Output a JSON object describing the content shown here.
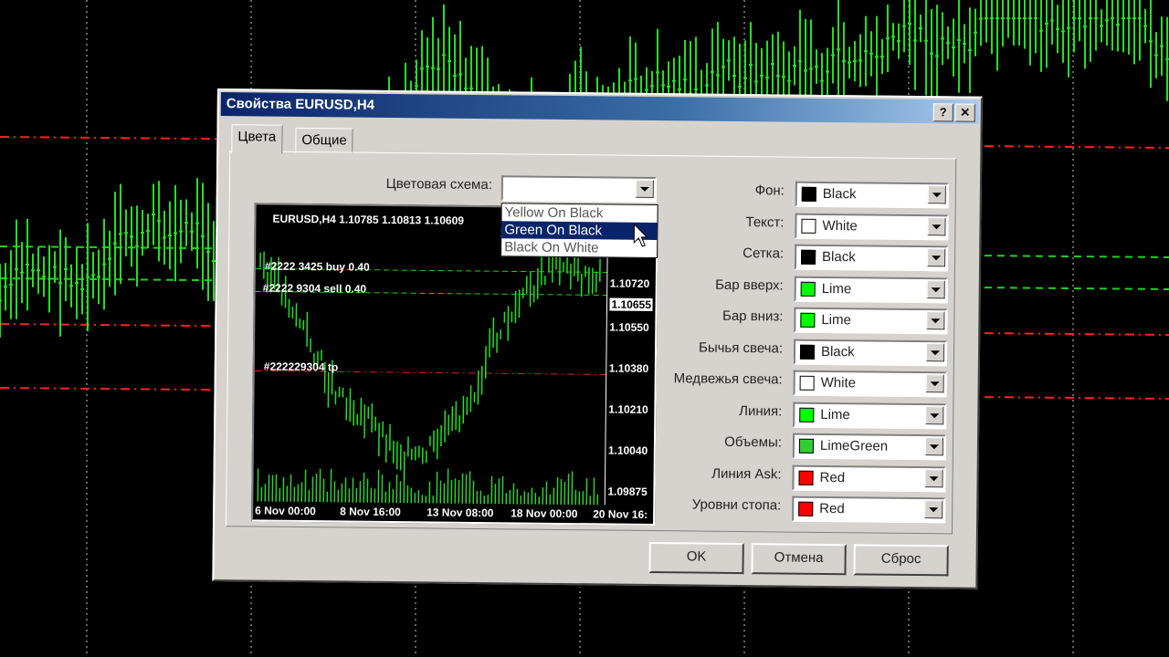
{
  "dialog": {
    "title": "Свойства EURUSD,H4",
    "help_btn": "?",
    "close_btn": "✕",
    "tabs": [
      {
        "label": "Цвета"
      },
      {
        "label": "Общие"
      }
    ],
    "scheme_label": "Цветовая схема:",
    "scheme_value": "",
    "scheme_options": [
      "Yellow On Black",
      "Green On Black",
      "Black On White"
    ],
    "scheme_highlighted": "Green On Black",
    "settings": [
      {
        "label": "Фон:",
        "value": "Black",
        "color": "#000000"
      },
      {
        "label": "Текст:",
        "value": "White",
        "color": "#ffffff"
      },
      {
        "label": "Сетка:",
        "value": "Black",
        "color": "#000000"
      },
      {
        "label": "Бар вверх:",
        "value": "Lime",
        "color": "#00ff00"
      },
      {
        "label": "Бар вниз:",
        "value": "Lime",
        "color": "#00ff00"
      },
      {
        "label": "Бычья свеча:",
        "value": "Black",
        "color": "#000000"
      },
      {
        "label": "Медвежья свеча:",
        "value": "White",
        "color": "#ffffff"
      },
      {
        "label": "Линия:",
        "value": "Lime",
        "color": "#00ff00"
      },
      {
        "label": "Объемы:",
        "value": "LimeGreen",
        "color": "#32cd32"
      },
      {
        "label": "Линия Ask:",
        "value": "Red",
        "color": "#ff0000"
      },
      {
        "label": "Уровни стопа:",
        "value": "Red",
        "color": "#ff0000"
      }
    ],
    "buttons": {
      "ok": "OK",
      "cancel": "Отмена",
      "reset": "Сброс"
    }
  },
  "preview": {
    "header": "EURUSD,H4  1.10785 1.10813 1.10609",
    "orders": [
      {
        "text": "#2222 3425 buy 0.40"
      },
      {
        "text": "#2222 9304 sell 0.40"
      },
      {
        "text": "#222229304 tp"
      }
    ],
    "prices": [
      "1.10720",
      "1.10655",
      "1.10550",
      "1.10380",
      "1.10210",
      "1.10040",
      "1.09875"
    ],
    "times": [
      "6 Nov 00:00",
      "8 Nov 16:00",
      "13 Nov 08:00",
      "18 Nov 00:00",
      "20 Nov 16:"
    ]
  },
  "colors": {
    "accent": "#0a246a",
    "chart_line": "#00e000",
    "level": "#ff2020",
    "dialog_bg": "#d6d3ce"
  }
}
